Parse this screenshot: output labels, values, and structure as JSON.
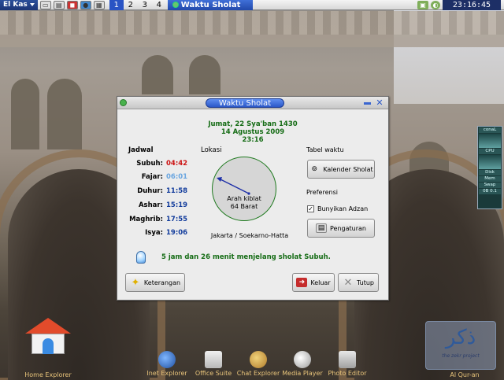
{
  "panel": {
    "menu_label": "El Kas",
    "workspaces": [
      "1",
      "2",
      "3",
      "4"
    ],
    "active_workspace": "1",
    "task_title": "Waktu Sholat",
    "clock": "23:16:45"
  },
  "dialog": {
    "title": "Waktu Sholat",
    "hijri_date": "Jumat, 22 Sya'ban 1430",
    "gregorian_date": "14 Agustus 2009",
    "time": "23:16",
    "jadwal_title": "Jadwal",
    "prayers": [
      {
        "name": "Subuh:",
        "time": "04:42",
        "color": "#cc1111"
      },
      {
        "name": "Fajar:",
        "time": "06:01",
        "color": "#6aa6e0"
      },
      {
        "name": "Duhur:",
        "time": "11:58",
        "color": "#123c9c"
      },
      {
        "name": "Ashar:",
        "time": "15:19",
        "color": "#123c9c"
      },
      {
        "name": "Maghrib:",
        "time": "17:55",
        "color": "#123c9c"
      },
      {
        "name": "Isya:",
        "time": "19:06",
        "color": "#123c9c"
      }
    ],
    "lokasi_title": "Lokasi",
    "compass_label_1": "Arah kiblat",
    "compass_label_2": "64 Barat",
    "city": "Jakarta / Soekarno-Hatta",
    "tabel_waktu_title": "Tabel waktu",
    "kalender_button": "Kalender Sholat",
    "preferensi_title": "Preferensi",
    "adzan_label": "Bunyikan Adzan",
    "adzan_checked": true,
    "pengaturan_button": "Pengaturan",
    "info_text": "5 jam dan 26 menit menjelang sholat Subuh.",
    "keterangan_button": "Keterangan",
    "keluar_button": "Keluar",
    "tutup_button": "Tutup"
  },
  "desktop": {
    "home_label": "Home Explorer",
    "dock": [
      "Inet Explorer",
      "Office Suite",
      "Chat Explorer",
      "Media Player",
      "Photo Editor"
    ],
    "quran_label": "Al Qur-an",
    "logo_text": "the zekr project"
  },
  "sysmon": {
    "top_label": "conaL",
    "cpu": "CPU",
    "disk": "Disk",
    "mem": "Mem",
    "swap": "Swap",
    "net": "0B 0.1"
  },
  "colors": {
    "panel_blue": "#2a54c4",
    "green_text": "#156c15",
    "red_time": "#cc1111"
  }
}
